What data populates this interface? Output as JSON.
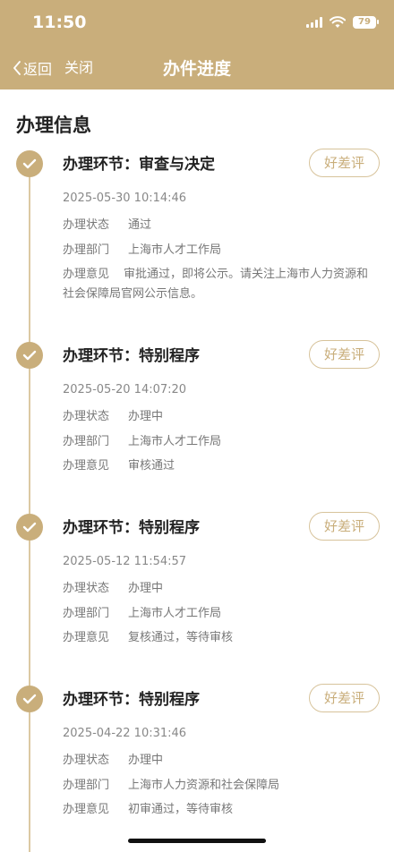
{
  "status_bar": {
    "time": "11:50",
    "battery": "79"
  },
  "nav": {
    "back_label": "返回",
    "close_label": "关闭",
    "title": "办件进度"
  },
  "section": {
    "title": "办理信息"
  },
  "labels": {
    "status": "办理状态",
    "department": "办理部门",
    "opinion": "办理意见"
  },
  "steps": [
    {
      "title": "办理环节：审查与决定",
      "rate_label": "好差评",
      "time": "2025-05-30 10:14:46",
      "status": "通过",
      "department": "上海市人才工作局",
      "opinion": "审批通过，即将公示。请关注上海市人力资源和社会保障局官网公示信息。"
    },
    {
      "title": "办理环节：特别程序",
      "rate_label": "好差评",
      "time": "2025-05-20 14:07:20",
      "status": "办理中",
      "department": "上海市人才工作局",
      "opinion": "审核通过"
    },
    {
      "title": "办理环节：特别程序",
      "rate_label": "好差评",
      "time": "2025-05-12 11:54:57",
      "status": "办理中",
      "department": "上海市人才工作局",
      "opinion": "复核通过，等待审核"
    },
    {
      "title": "办理环节：特别程序",
      "rate_label": "好差评",
      "time": "2025-04-22 10:31:46",
      "status": "办理中",
      "department": "上海市人力资源和社会保障局",
      "opinion": "初审通过，等待审核"
    }
  ],
  "colors": {
    "accent": "#c9ae7b",
    "timeline": "#dcc9a3",
    "rate_border": "#d7c39b"
  }
}
